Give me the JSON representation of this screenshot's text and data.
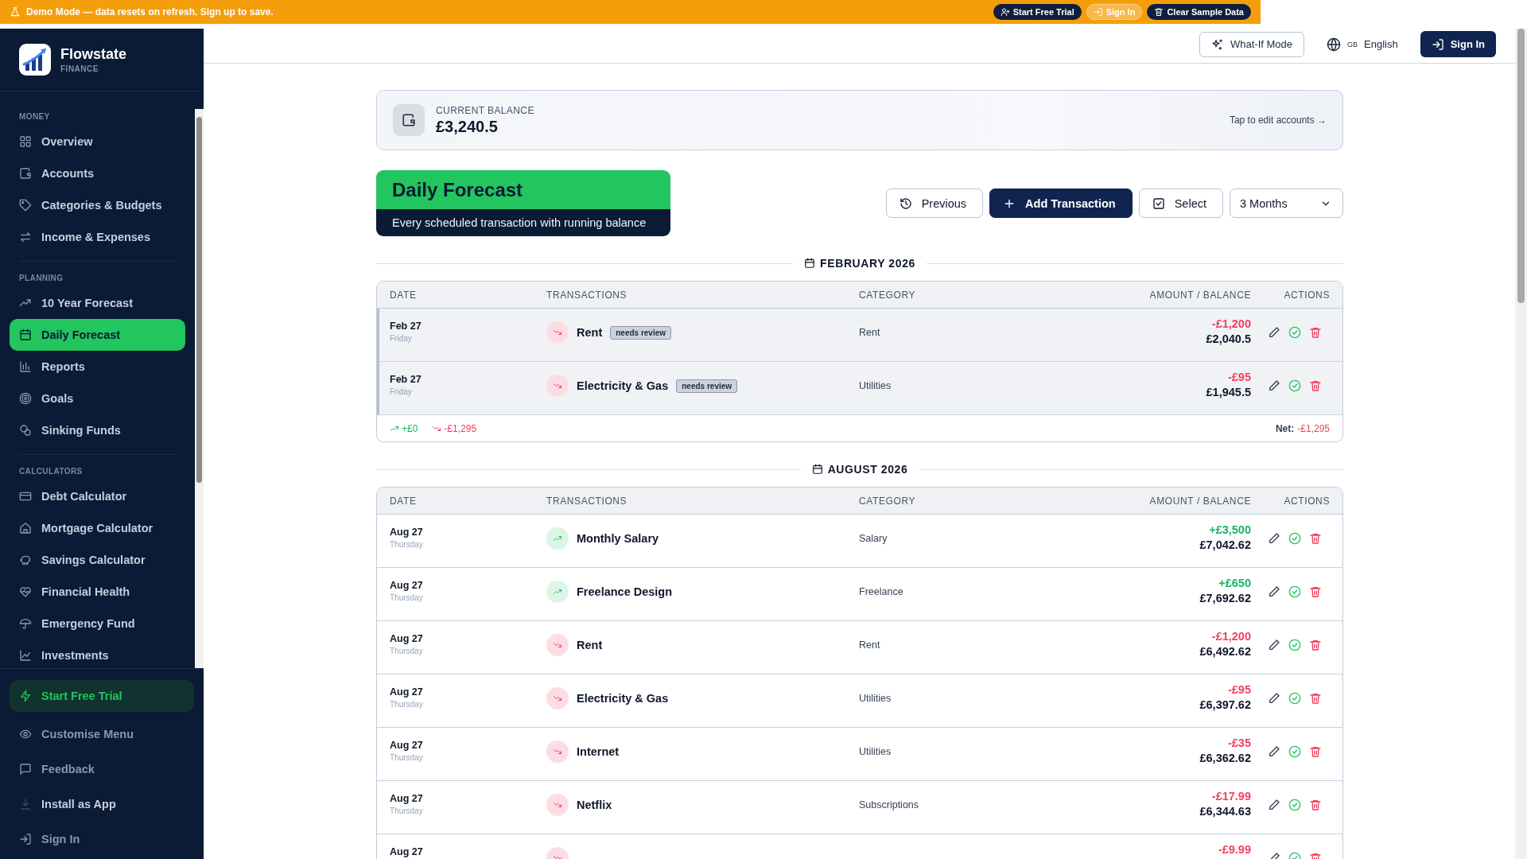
{
  "demo_banner": {
    "message": "Demo Mode — data resets on refresh. Sign up to save.",
    "buttons": [
      {
        "label": "Start Free Trial",
        "kind": "dark"
      },
      {
        "label": "Sign In",
        "kind": "outline"
      },
      {
        "label": "Clear Sample Data",
        "kind": "dark"
      }
    ]
  },
  "sidebar": {
    "brand": "Flowstate",
    "tagline": "FINANCE",
    "sections": [
      {
        "title": "MONEY",
        "items": [
          {
            "label": "Overview",
            "selected": false
          },
          {
            "label": "Accounts",
            "selected": false
          },
          {
            "label": "Categories & Budgets",
            "selected": false
          },
          {
            "label": "Income & Expenses",
            "selected": false
          }
        ]
      },
      {
        "title": "PLANNING",
        "items": [
          {
            "label": "10 Year Forecast",
            "selected": false
          },
          {
            "label": "Daily Forecast",
            "selected": true
          },
          {
            "label": "Reports",
            "selected": false
          },
          {
            "label": "Goals",
            "selected": false
          },
          {
            "label": "Sinking Funds",
            "selected": false
          }
        ]
      },
      {
        "title": "CALCULATORS",
        "items": [
          {
            "label": "Debt Calculator",
            "selected": false
          },
          {
            "label": "Mortgage Calculator",
            "selected": false
          },
          {
            "label": "Savings Calculator",
            "selected": false
          },
          {
            "label": "Financial Health",
            "selected": false
          },
          {
            "label": "Emergency Fund",
            "selected": false
          },
          {
            "label": "Investments",
            "selected": false
          }
        ]
      }
    ],
    "footer_items": [
      {
        "label": "Start Free Trial",
        "kind": "trial"
      },
      {
        "label": "Customise Menu",
        "kind": "muted"
      },
      {
        "label": "Feedback",
        "kind": "muted"
      },
      {
        "label": "Install as App",
        "kind": "plain"
      },
      {
        "label": "Sign In",
        "kind": "muted"
      }
    ]
  },
  "header": {
    "what_if": "What-If Mode",
    "region": "GB",
    "language": "English",
    "sign_in": "Sign In"
  },
  "balance": {
    "label": "CURRENT BALANCE",
    "value": "£3,240.5",
    "link": "Tap to edit accounts →"
  },
  "page": {
    "title": "Daily Forecast",
    "subtitle": "Every scheduled transaction with running balance"
  },
  "toolbar": {
    "previous": "Previous",
    "add": "Add Transaction",
    "select": "Select",
    "range": "3 Months"
  },
  "months": [
    {
      "title": "FEBRUARY 2026",
      "columns": [
        "DATE",
        "TRANSACTIONS",
        "CATEGORY",
        "AMOUNT / BALANCE",
        "ACTIONS"
      ],
      "rows": [
        {
          "date": "Feb 27",
          "weekday": "Friday",
          "name": "Rent",
          "badge": "needs review",
          "category": "Rent",
          "kind": "expense",
          "amount": "-£1,200",
          "balance": "£2,040.5"
        },
        {
          "date": "Feb 27",
          "weekday": "Friday",
          "name": "Electricity & Gas",
          "badge": "needs review",
          "category": "Utilities",
          "kind": "expense",
          "amount": "-£95",
          "balance": "£1,945.5"
        }
      ],
      "summary": {
        "income": "+£0",
        "expense": "-£1,295",
        "net_label": "Net:",
        "net": "-£1,295"
      }
    },
    {
      "title": "AUGUST 2026",
      "columns": [
        "DATE",
        "TRANSACTIONS",
        "CATEGORY",
        "AMOUNT / BALANCE",
        "ACTIONS"
      ],
      "rows": [
        {
          "date": "Aug 27",
          "weekday": "Thursday",
          "name": "Monthly Salary",
          "category": "Salary",
          "kind": "income",
          "amount": "+£3,500",
          "balance": "£7,042.62"
        },
        {
          "date": "Aug 27",
          "weekday": "Thursday",
          "name": "Freelance Design",
          "category": "Freelance",
          "kind": "income",
          "amount": "+£650",
          "balance": "£7,692.62"
        },
        {
          "date": "Aug 27",
          "weekday": "Thursday",
          "name": "Rent",
          "category": "Rent",
          "kind": "expense",
          "amount": "-£1,200",
          "balance": "£6,492.62"
        },
        {
          "date": "Aug 27",
          "weekday": "Thursday",
          "name": "Electricity & Gas",
          "category": "Utilities",
          "kind": "expense",
          "amount": "-£95",
          "balance": "£6,397.62"
        },
        {
          "date": "Aug 27",
          "weekday": "Thursday",
          "name": "Internet",
          "category": "Utilities",
          "kind": "expense",
          "amount": "-£35",
          "balance": "£6,362.62"
        },
        {
          "date": "Aug 27",
          "weekday": "Thursday",
          "name": "Netflix",
          "category": "Subscriptions",
          "kind": "expense",
          "amount": "-£17.99",
          "balance": "£6,344.63"
        },
        {
          "date": "Aug 27",
          "kind": "expense",
          "amount": "-£9.99"
        }
      ]
    }
  ]
}
